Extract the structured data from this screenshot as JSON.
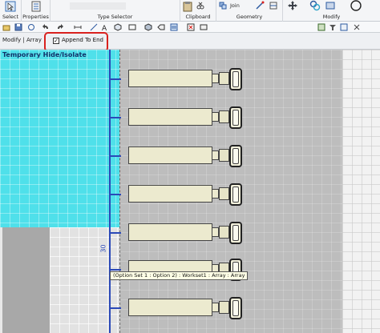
{
  "ribbon": {
    "select_label": "Select",
    "properties_label": "Properties",
    "type_selector_label": "Type Selector",
    "clipboard_label": "Clipboard",
    "geometry_label": "Geometry",
    "join_label": "Join",
    "modify_label": "Modify"
  },
  "options_bar": {
    "context_label": "Modify | Array",
    "append_to_end": {
      "label": "Append To End",
      "checked": true
    }
  },
  "view": {
    "title": "Temporary Hide/Isolate",
    "dimension_value": "30",
    "tooltip": "(Option Set 1 : Option 2) : Workset1 : Array : Array"
  },
  "colors": {
    "highlight_red": "#d9211e",
    "isolate_cyan": "#4fe0ea",
    "dimension_blue": "#2b49b8",
    "element_fill": "#eceacf"
  },
  "icons": [
    "select-icon",
    "properties-icon",
    "paste-icon",
    "cut-icon",
    "join-icon",
    "geometry-icon",
    "move-icon",
    "copy-icon",
    "rotate-icon",
    "circle-icon"
  ]
}
